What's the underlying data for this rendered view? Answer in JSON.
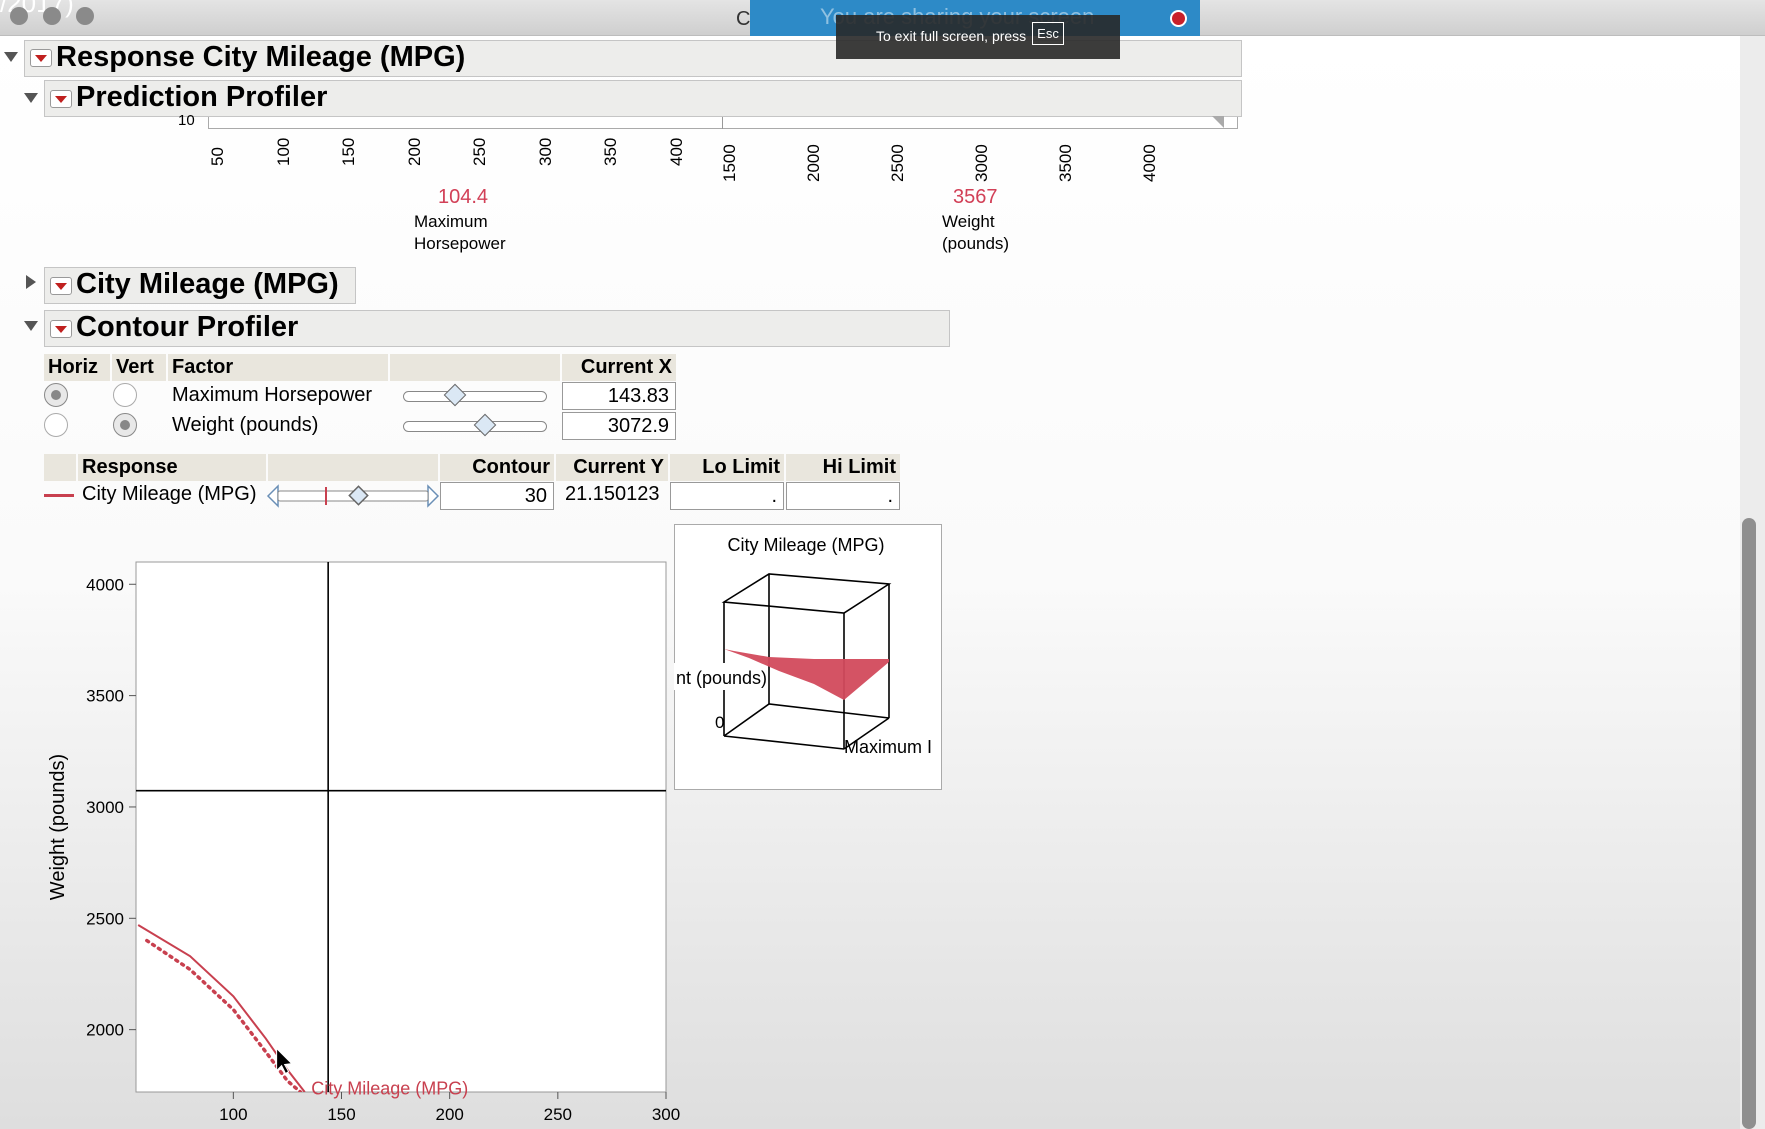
{
  "window": {
    "corner_text": "/2017)",
    "title": "Cars 199",
    "share_text": "You are sharing your screen",
    "toast_text": "To exit full screen, press",
    "toast_key": "Esc"
  },
  "report": {
    "response_title": "Response City Mileage (MPG)",
    "prediction_profiler_title": "Prediction Profiler",
    "city_mileage_title": "City Mileage (MPG)",
    "contour_profiler_title": "Contour Profiler"
  },
  "prediction_profiler": {
    "hp_ticks": [
      "50",
      "100",
      "150",
      "200",
      "250",
      "300",
      "350",
      "400"
    ],
    "weight_ticks": [
      "1500",
      "2000",
      "2500",
      "3000",
      "3500",
      "4000"
    ],
    "hp_value": "104.4",
    "hp_label_1": "Maximum",
    "hp_label_2": "Horsepower",
    "weight_value": "3567",
    "weight_label_1": "Weight",
    "weight_label_2": "(pounds)",
    "top_tick_fragment": "10"
  },
  "factor_table": {
    "headers": [
      "Horiz",
      "Vert",
      "Factor",
      "",
      "Current X"
    ],
    "rows": [
      {
        "factor": "Maximum Horsepower",
        "current_x": "143.83",
        "horiz": true,
        "vert": false,
        "slider_pos": 0.36
      },
      {
        "factor": "Weight (pounds)",
        "current_x": "3072.9",
        "horiz": false,
        "vert": true,
        "slider_pos": 0.57
      }
    ]
  },
  "response_table": {
    "headers": [
      "Response",
      "",
      "Contour",
      "Current Y",
      "Lo Limit",
      "Hi Limit"
    ],
    "row": {
      "response": "City Mileage (MPG)",
      "contour": "30",
      "current_y": "21.150123",
      "lo_limit": ".",
      "hi_limit": "."
    }
  },
  "chart_data": {
    "type": "line",
    "title": "",
    "xlabel": "Maximum Horsepower",
    "ylabel": "Weight (pounds)",
    "xlim": [
      55,
      300
    ],
    "ylim": [
      1720,
      4100
    ],
    "xticks": [
      100,
      150,
      200,
      250,
      300
    ],
    "yticks": [
      2000,
      2500,
      3000,
      3500,
      4000
    ],
    "crosshair": {
      "x": 143.83,
      "y": 3072.9
    },
    "series": [
      {
        "name": "City Mileage (MPG)",
        "style": "solid",
        "color": "#c8404f",
        "x": [
          56,
          80,
          100,
          115,
          125,
          133
        ],
        "y": [
          2470,
          2330,
          2150,
          1960,
          1820,
          1720
        ]
      },
      {
        "name": "",
        "style": "dotted",
        "color": "#c8404f",
        "x": [
          60,
          80,
          100,
          115,
          125,
          131
        ],
        "y": [
          2400,
          2270,
          2090,
          1900,
          1770,
          1720
        ]
      }
    ],
    "contour_label": "City Mileage (MPG)"
  },
  "surface_plot": {
    "title": "City Mileage (MPG)",
    "side_label": "nt (pounds)",
    "zero_label": "0",
    "bottom_label": "Maximum I",
    "fill_color": "#d24a5c"
  }
}
